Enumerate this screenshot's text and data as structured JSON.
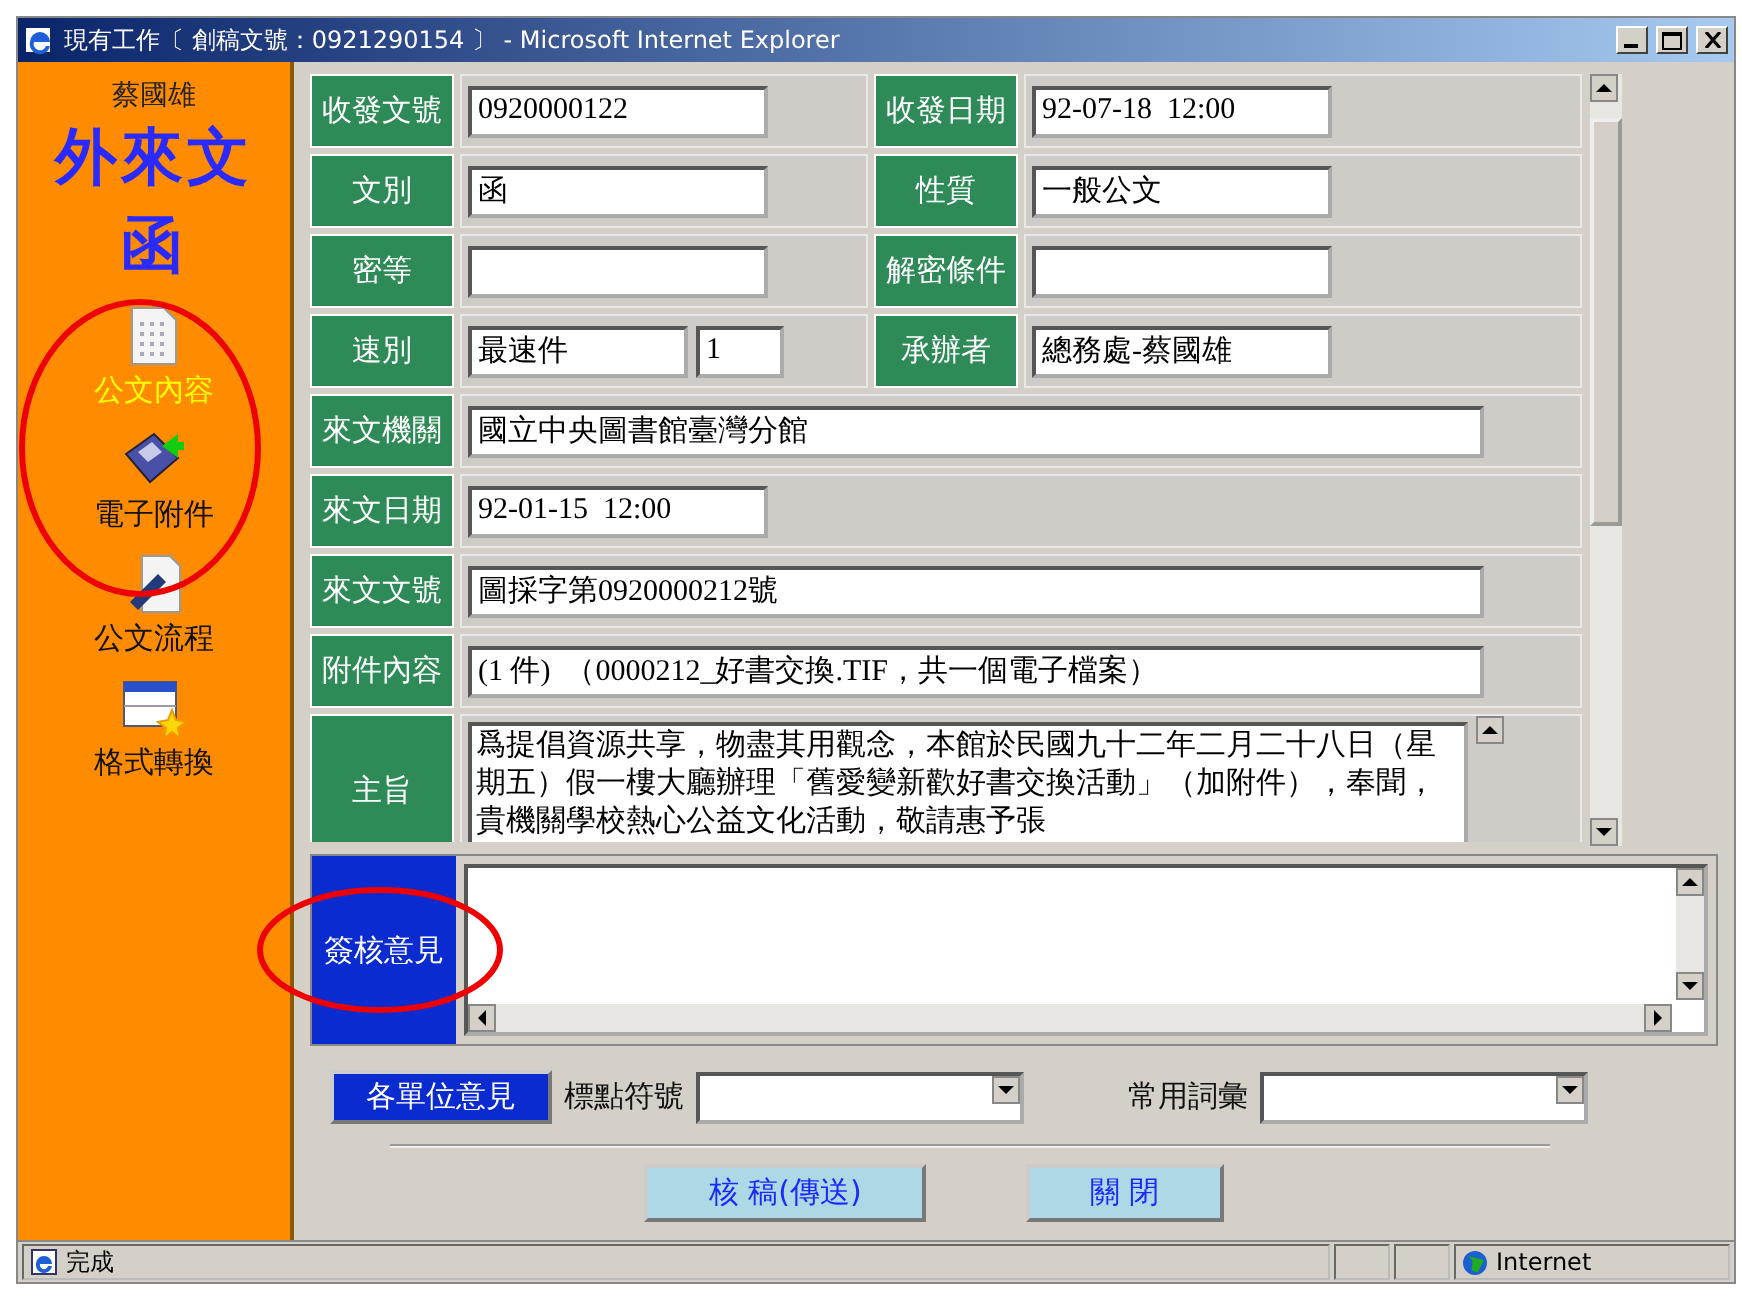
{
  "window": {
    "title": "現有工作〔 創稿文號：0921290154 〕 - Microsoft Internet Explorer"
  },
  "sidebar": {
    "user": "蔡國雄",
    "heading": "外來文函",
    "items": [
      {
        "label": "公文內容",
        "kind": "document",
        "selected": true
      },
      {
        "label": "電子附件",
        "kind": "floppy",
        "selected": false
      },
      {
        "label": "公文流程",
        "kind": "pen",
        "selected": false
      },
      {
        "label": "格式轉換",
        "kind": "window",
        "selected": false
      }
    ]
  },
  "form": {
    "rows": [
      {
        "kind": "pair",
        "fields": [
          {
            "label": "收發文號",
            "value": "0920000122"
          },
          {
            "label": "收發日期",
            "value": "92-07-18  12:00"
          }
        ]
      },
      {
        "kind": "pair",
        "fields": [
          {
            "label": "文別",
            "value": "函"
          },
          {
            "label": "性質",
            "value": "一般公文"
          }
        ]
      },
      {
        "kind": "pair",
        "fields": [
          {
            "label": "密等"
          },
          {
            "label": "解密條件"
          }
        ]
      },
      {
        "kind": "pair",
        "fields": [
          {
            "label": "速別",
            "value": "最速件",
            "extra": "1"
          },
          {
            "label": "承辦者",
            "value": "總務處-蔡國雄"
          }
        ]
      },
      {
        "kind": "wide",
        "fields": [
          {
            "label": "來文機關",
            "value": "國立中央圖書館臺灣分館"
          }
        ]
      },
      {
        "kind": "short",
        "fields": [
          {
            "label": "來文日期",
            "value": "92-01-15  12:00"
          }
        ]
      },
      {
        "kind": "wide",
        "fields": [
          {
            "label": "來文文號",
            "value": "圖採字第0920000212號"
          }
        ]
      },
      {
        "kind": "wide",
        "fields": [
          {
            "label": "附件內容",
            "value": "(1 件)  （0000212_好書交換.TIF，共一個電子檔案）"
          }
        ]
      },
      {
        "kind": "text",
        "fields": [
          {
            "label": "主旨",
            "value": "爲提倡資源共享，物盡其用觀念，本館於民國九十二年二月二十八日（星期五）假一樓大廳辦理「舊愛變新歡好書交換活動」（加附件），奉聞，貴機關學校熱心公益文化活動，敬請惠予張"
          }
        ]
      }
    ]
  },
  "comment": {
    "label": "簽核意見"
  },
  "toolbar": {
    "button": "各單位意見",
    "selects": [
      {
        "label": "標點符號"
      },
      {
        "label": "常用詞彙"
      }
    ]
  },
  "actions": [
    "核 稿(傳送)",
    "關 閉"
  ],
  "status_bar": {
    "text": "完成",
    "zone": "Internet"
  }
}
